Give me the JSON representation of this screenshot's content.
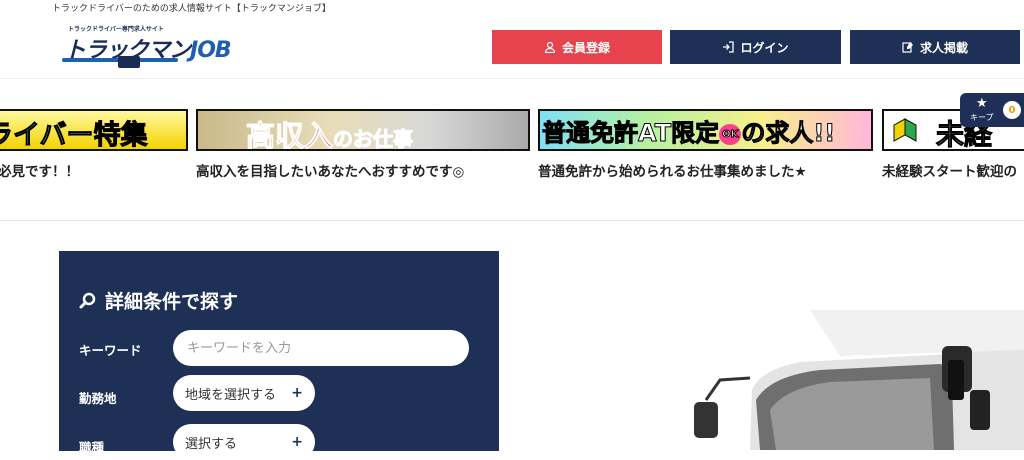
{
  "header": {
    "tagline": "トラックドライバーのための求人情報サイト【トラックマンジョブ】",
    "logo_small": "トラックドライバー専門求人サイト",
    "logo_main": "トラックマン",
    "logo_job": "JOB",
    "buttons": {
      "register": "会員登録",
      "login": "ログイン",
      "post": "求人掲載"
    },
    "colors": {
      "register": "#e6434f",
      "navy": "#1e3056"
    }
  },
  "banners": [
    {
      "text": "ライバー特集",
      "caption": "必見です！！"
    },
    {
      "text_main": "高収入",
      "text_sub": "のお仕事",
      "caption": "高収入を目指したいあなたへおすすめです◎"
    },
    {
      "text_a": "普通免許AT限定",
      "ok": "OK",
      "text_b": "の求人!!",
      "caption": "普通免許から始められるお仕事集めました★"
    },
    {
      "text": "未経",
      "caption": "未経験スタート歓迎の"
    }
  ],
  "keep": {
    "label": "キープ",
    "count": "0"
  },
  "search": {
    "title": "詳細条件で探す",
    "keyword_label": "キーワード",
    "keyword_placeholder": "キーワードを入力",
    "location_label": "勤務地",
    "location_value": "地域を選択する",
    "job_label": "職種",
    "job_value": "選択する"
  }
}
